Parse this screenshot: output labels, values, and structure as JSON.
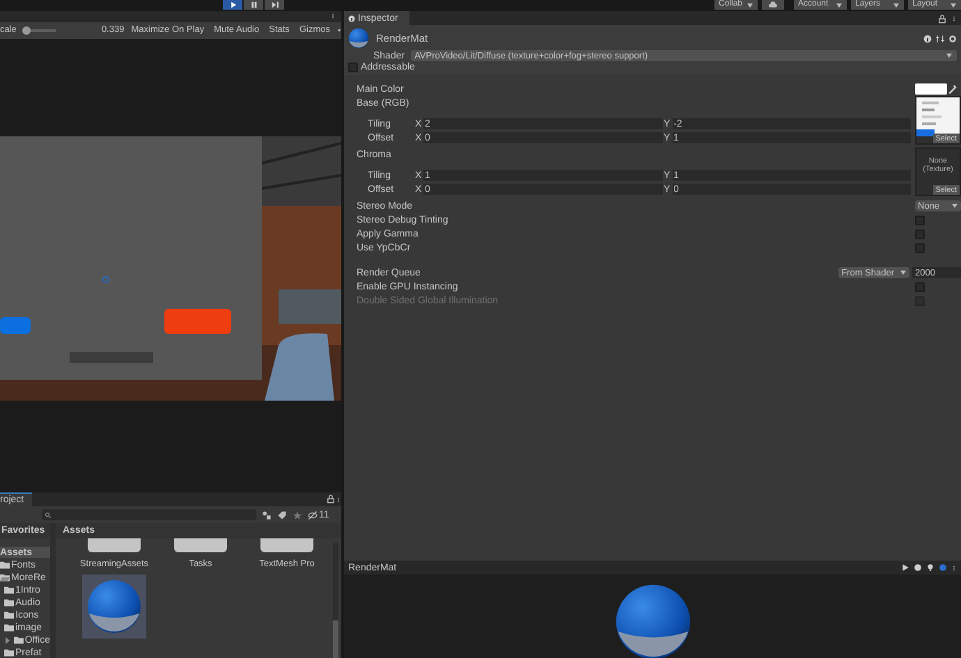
{
  "toolbar": {
    "play_controls": [
      {
        "kind": "play",
        "selected": true
      },
      {
        "kind": "pause",
        "selected": false
      },
      {
        "kind": "step",
        "selected": false
      }
    ],
    "menus": [
      "Collab",
      "Account",
      "Layers",
      "Layout"
    ]
  },
  "game_view": {
    "scale_label": "cale",
    "scale_value": "0.339",
    "level": 0.05,
    "buttons": [
      {
        "label": "Maximize On Play",
        "selected": false
      },
      {
        "label": "Mute Audio",
        "selected": false
      },
      {
        "label": "Stats",
        "selected": false
      },
      {
        "label": "Gizmos",
        "selected": false
      }
    ]
  },
  "project": {
    "tab": "roject",
    "hidden_count": "11",
    "favorites": "Favorites",
    "breadcrumb": "Assets",
    "tree": [
      {
        "label": "Assets",
        "selected": true,
        "children": [
          {
            "label": "Fonts",
            "selected": false
          },
          {
            "label": "MoreRe",
            "selected": false,
            "expanded": true,
            "children": [
              {
                "label": "1Intro",
                "selected": false
              },
              {
                "label": "Audio",
                "selected": false
              },
              {
                "label": "Icons",
                "selected": false
              },
              {
                "label": "image",
                "selected": false
              },
              {
                "label": "Office",
                "selected": false,
                "expanded": false
              },
              {
                "label": "Prefat",
                "selected": false
              }
            ]
          }
        ]
      }
    ],
    "items": [
      {
        "kind": "folder",
        "label": "StreamingAssets"
      },
      {
        "kind": "folder",
        "label": "Tasks"
      },
      {
        "kind": "folder",
        "label": "TextMesh Pro"
      },
      {
        "kind": "material"
      }
    ]
  },
  "inspector": {
    "tab": "Inspector",
    "material": "RenderMat",
    "shader_label": "Shader",
    "shader": "AVProVideo/Lit/Diffuse (texture+color+fog+stereo support)",
    "addressable": {
      "label": "Addressable",
      "checked": false
    },
    "properties": [
      {
        "kind": "color",
        "label": "Main Color",
        "color": "#ffffff"
      },
      {
        "kind": "texture",
        "label": "Base (RGB)",
        "rows": [
          {
            "label": "Tiling",
            "fields": [
              {
                "axis": "X",
                "value": "2"
              },
              {
                "axis": "Y",
                "value": "-2"
              }
            ]
          },
          {
            "label": "Offset",
            "fields": [
              {
                "axis": "X",
                "value": "0"
              },
              {
                "axis": "Y",
                "value": "1"
              }
            ]
          }
        ],
        "slot": {
          "select": "Select"
        }
      },
      {
        "kind": "texture",
        "label": "Chroma",
        "rows": [
          {
            "label": "Tiling",
            "fields": [
              {
                "axis": "X",
                "value": "1"
              },
              {
                "axis": "Y",
                "value": "1"
              }
            ]
          },
          {
            "label": "Offset",
            "fields": [
              {
                "axis": "X",
                "value": "0"
              },
              {
                "axis": "Y",
                "value": "0"
              }
            ]
          }
        ],
        "slot": {
          "kind": "empty",
          "text": "None (Texture)",
          "select": "Select"
        }
      },
      {
        "kind": "dropdown",
        "label": "Stereo Mode",
        "value": "None"
      },
      {
        "kind": "toggle",
        "label": "Stereo Debug Tinting",
        "checked": false,
        "disabled": false
      },
      {
        "kind": "toggle",
        "label": "Apply Gamma",
        "checked": false,
        "disabled": false
      },
      {
        "kind": "toggle",
        "label": "Use YpCbCr",
        "checked": false,
        "disabled": false
      },
      {
        "kind": "queue",
        "label": "Render Queue",
        "mode": "From Shader",
        "value": "2000"
      },
      {
        "kind": "toggle",
        "label": "Enable GPU Instancing",
        "checked": false,
        "disabled": false
      },
      {
        "kind": "toggle",
        "label": "Double Sided Global Illumination",
        "checked": false,
        "disabled": true
      }
    ]
  },
  "preview": {
    "title": "RenderMat"
  }
}
